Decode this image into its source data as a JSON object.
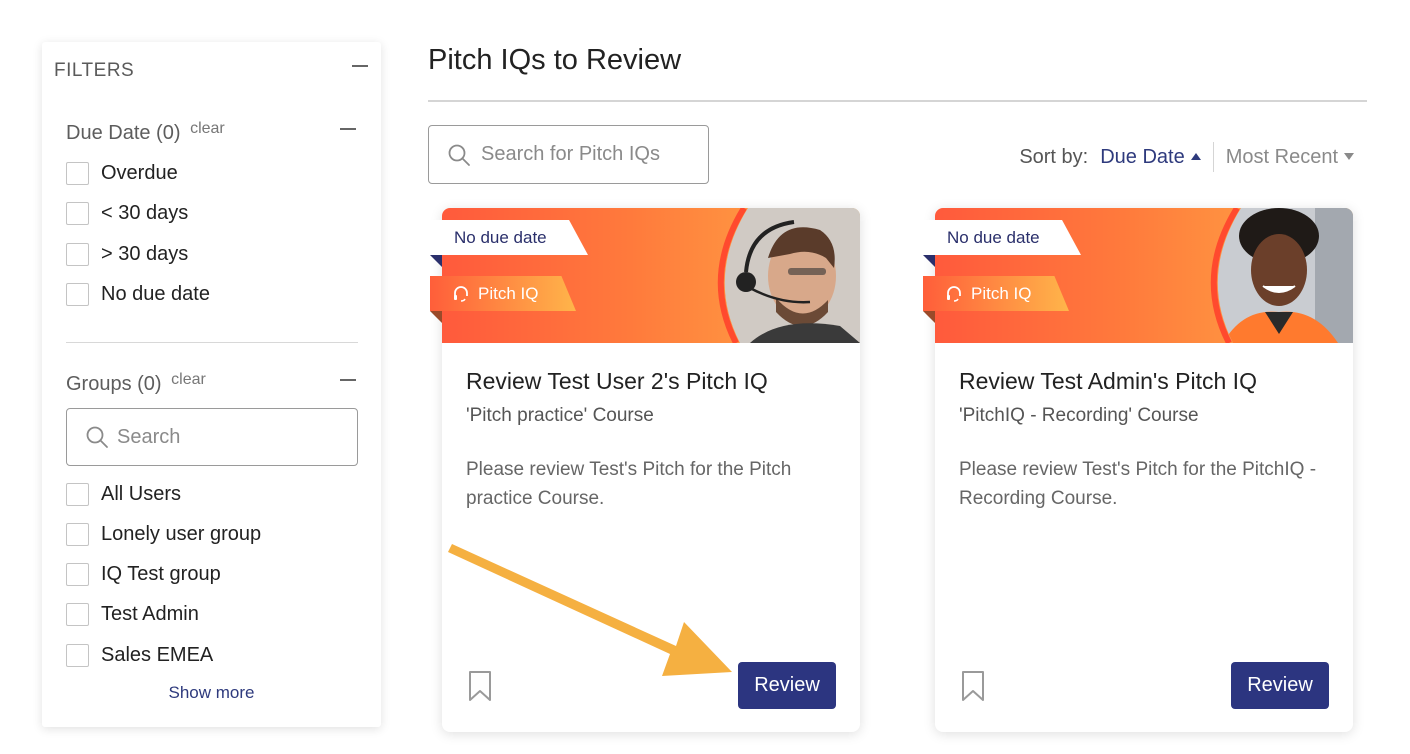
{
  "filters": {
    "title": "FILTERS",
    "due_date": {
      "title": "Due Date (0)",
      "clear_label": "clear",
      "options": [
        "Overdue",
        "< 30 days",
        "> 30 days",
        "No due date"
      ]
    },
    "groups": {
      "title": "Groups (0)",
      "clear_label": "clear",
      "search_placeholder": "Search",
      "options": [
        "All Users",
        "Lonely user group",
        "IQ Test group",
        "Test Admin",
        "Sales EMEA"
      ],
      "show_more_label": "Show more"
    }
  },
  "main": {
    "title": "Pitch IQs to Review",
    "search_placeholder": "Search for Pitch IQs",
    "sort": {
      "label": "Sort by:",
      "active": "Due Date",
      "other": "Most Recent"
    }
  },
  "cards": [
    {
      "due_tag": "No due date",
      "type_tag": "Pitch IQ",
      "title": "Review Test User 2's Pitch IQ",
      "course": "'Pitch practice' Course",
      "description": "Please review Test's Pitch for the Pitch practice Course.",
      "button_label": "Review"
    },
    {
      "due_tag": "No due date",
      "type_tag": "Pitch IQ",
      "title": "Review Test Admin's Pitch IQ",
      "course": "'PitchIQ - Recording' Course",
      "description": "Please review Test's Pitch for the PitchIQ - Recording Course.",
      "button_label": "Review"
    }
  ],
  "colors": {
    "brand_navy": "#2c3580",
    "banner_start": "#ff5a3c",
    "banner_end": "#ffab45",
    "annotation_arrow": "#f5b041"
  }
}
